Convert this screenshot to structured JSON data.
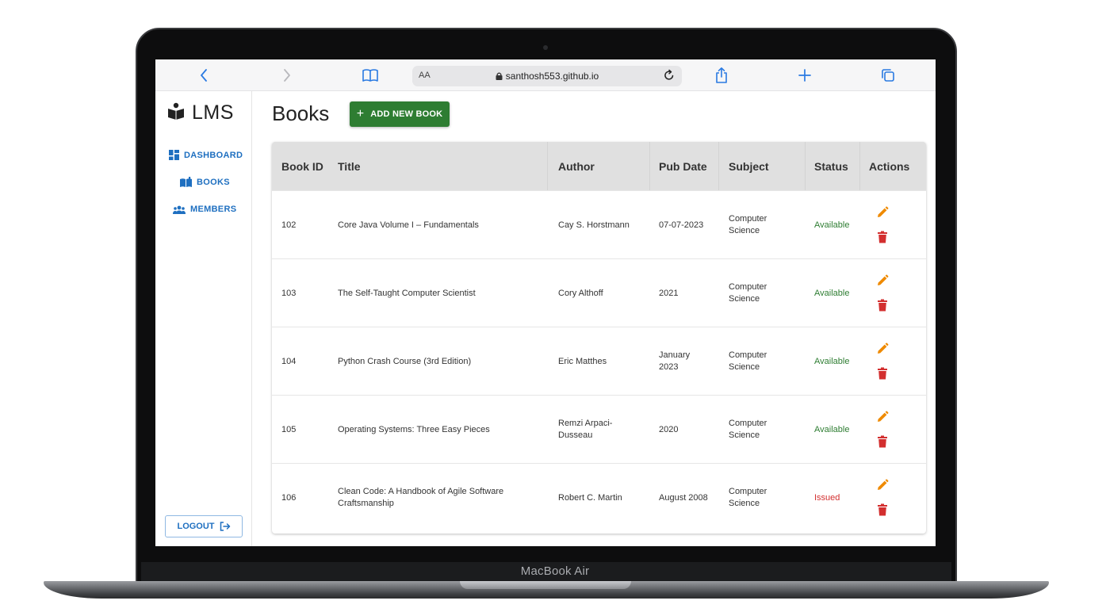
{
  "device": {
    "model_label": "MacBook Air"
  },
  "browser": {
    "aa_label": "AA",
    "url": "santhosh553.github.io",
    "icons": [
      "back-icon",
      "forward-icon",
      "bookmarks-icon",
      "lock-icon",
      "reload-icon",
      "share-icon",
      "new-tab-icon",
      "tabs-icon"
    ]
  },
  "sidebar": {
    "brand": "LMS",
    "items": [
      {
        "label": "DASHBOARD",
        "icon": "dashboard-icon"
      },
      {
        "label": "BOOKS",
        "icon": "books-icon"
      },
      {
        "label": "MEMBERS",
        "icon": "members-icon"
      }
    ],
    "logout_label": "LOGOUT"
  },
  "main": {
    "title": "Books",
    "add_button_label": "ADD NEW BOOK",
    "table": {
      "columns": [
        "Book ID",
        "Title",
        "Author",
        "Pub Date",
        "Subject",
        "Status",
        "Actions"
      ],
      "rows": [
        {
          "id": "102",
          "title": "Core Java Volume I – Fundamentals",
          "author": "Cay S. Horstmann",
          "pub_date": "07-07-2023",
          "subject": "Computer Science",
          "status": "Available"
        },
        {
          "id": "103",
          "title": "The Self-Taught Computer Scientist",
          "author": "Cory Althoff",
          "pub_date": "2021",
          "subject": "Computer Science",
          "status": "Available"
        },
        {
          "id": "104",
          "title": "Python Crash Course (3rd Edition)",
          "author": "Eric Matthes",
          "pub_date": "January 2023",
          "subject": "Computer Science",
          "status": "Available"
        },
        {
          "id": "105",
          "title": "Operating Systems: Three Easy Pieces",
          "author": "Remzi Arpaci-Dusseau",
          "pub_date": "2020",
          "subject": "Computer Science",
          "status": "Available"
        },
        {
          "id": "106",
          "title": "Clean Code: A Handbook of Agile Software Craftsmanship",
          "author": "Robert C. Martin",
          "pub_date": "August 2008",
          "subject": "Computer Science",
          "status": "Issued"
        }
      ]
    }
  },
  "colors": {
    "primary_blue": "#1e6fc0",
    "add_button_green": "#2e7d32",
    "available_green": "#2e7d32",
    "issued_red": "#d32f2f",
    "edit_orange": "#ef8a00",
    "delete_red": "#d32f2f",
    "header_gray": "#e0e0e0"
  }
}
